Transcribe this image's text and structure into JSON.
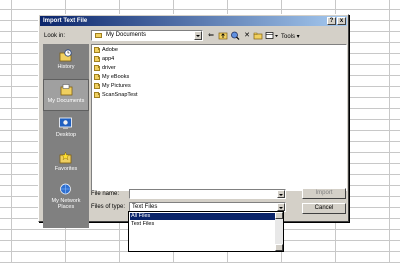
{
  "dialog": {
    "title": "Import Text File",
    "help_button": "?",
    "close_button": "x"
  },
  "lookin": {
    "label": "Look in:",
    "value": "My Documents",
    "tools_label": "Tools"
  },
  "places": [
    {
      "label": "History",
      "icon": "history-icon"
    },
    {
      "label": "My Documents",
      "icon": "my-documents-icon",
      "selected": true
    },
    {
      "label": "Desktop",
      "icon": "desktop-icon"
    },
    {
      "label": "Favorites",
      "icon": "favorites-icon"
    },
    {
      "label": "My Network Places",
      "icon": "network-places-icon"
    }
  ],
  "files": [
    {
      "name": "Adobe"
    },
    {
      "name": "app4"
    },
    {
      "name": "driver"
    },
    {
      "name": "My eBooks"
    },
    {
      "name": "My Pictures"
    },
    {
      "name": "ScanSnapTest"
    }
  ],
  "filename": {
    "label": "File name:",
    "value": ""
  },
  "filetype": {
    "label": "Files of type:",
    "value": "Text Files",
    "options": [
      "All Files",
      "Text Files"
    ],
    "selected_index": 0
  },
  "buttons": {
    "import": "Import",
    "cancel": "Cancel"
  },
  "colors": {
    "title_start": "#0a246a",
    "title_end": "#a6caf0",
    "dialog_bg": "#d4d0c8",
    "places_bg": "#808080",
    "selection": "#0a246a"
  }
}
